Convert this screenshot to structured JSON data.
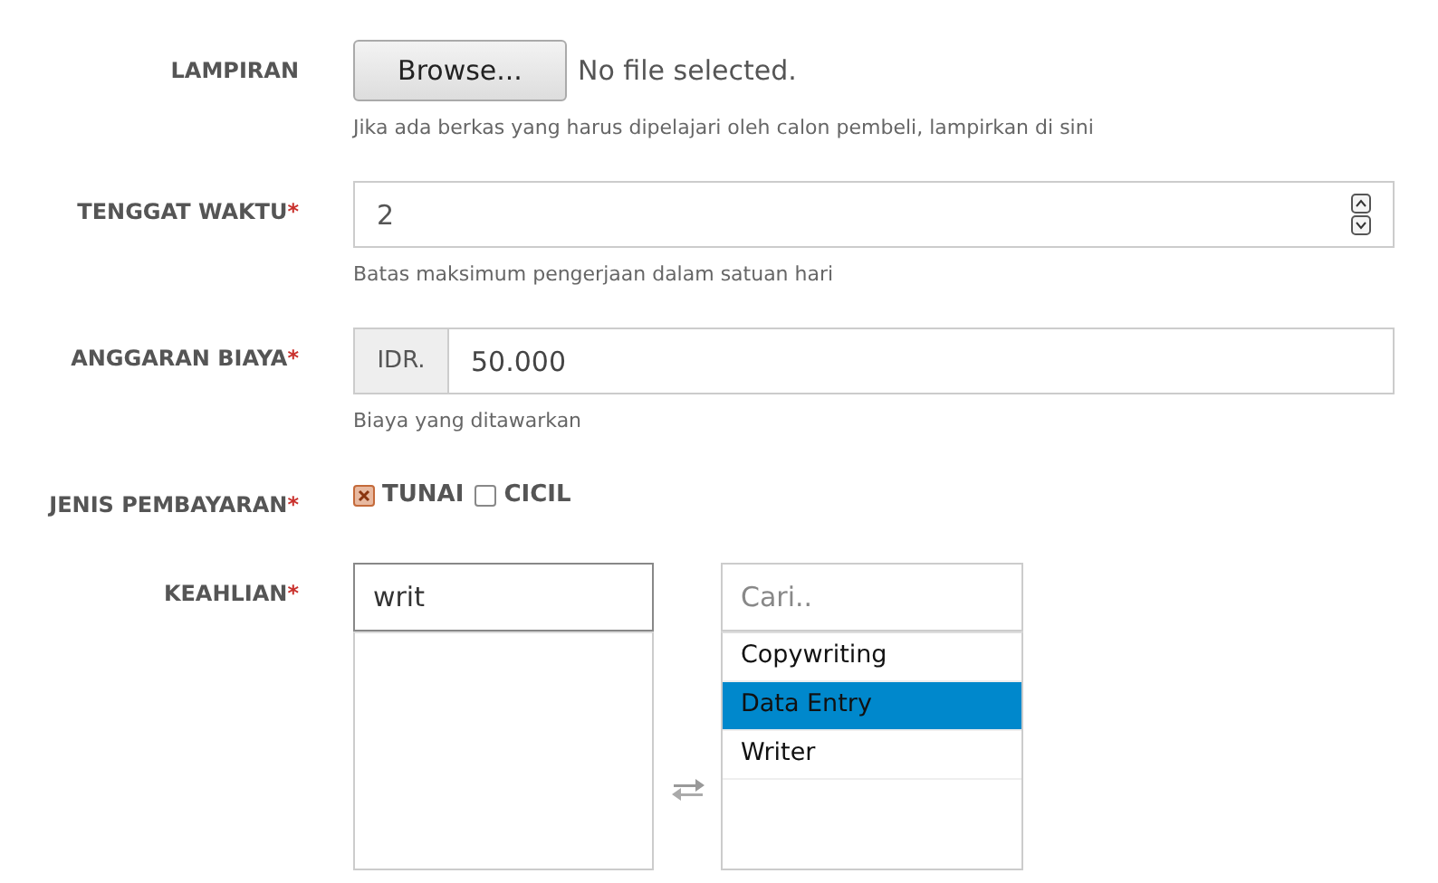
{
  "fields": [
    {
      "kind": "file",
      "label": "LAMPIRAN",
      "button": "Browse...",
      "status": "No file selected.",
      "help": "Jika ada berkas yang harus dipelajari oleh calon pembeli, lampirkan di sini"
    },
    {
      "kind": "number",
      "label": "TENGGAT WAKTU",
      "required_mark": "*",
      "value": "2",
      "help": "Batas maksimum pengerjaan dalam satuan hari"
    },
    {
      "kind": "money",
      "label": "ANGGARAN BIAYA",
      "required_mark": "*",
      "prefix": "IDR.",
      "value": "50.000",
      "help": "Biaya yang ditawarkan"
    },
    {
      "kind": "checks",
      "label": "JENIS PEMBAYARAN",
      "required_mark": "*",
      "options": [
        {
          "label": "TUNAI",
          "checked": true
        },
        {
          "label": "CICIL",
          "checked": false
        }
      ]
    },
    {
      "kind": "dual",
      "label": "KEAHLIAN",
      "required_mark": "*",
      "left_search": {
        "value": "writ"
      },
      "right_search": {
        "placeholder": "Cari.."
      },
      "right_items": [
        {
          "label": "Copywriting",
          "selected": false
        },
        {
          "label": "Data Entry",
          "selected": true
        },
        {
          "label": "Writer",
          "selected": false
        }
      ]
    }
  ]
}
